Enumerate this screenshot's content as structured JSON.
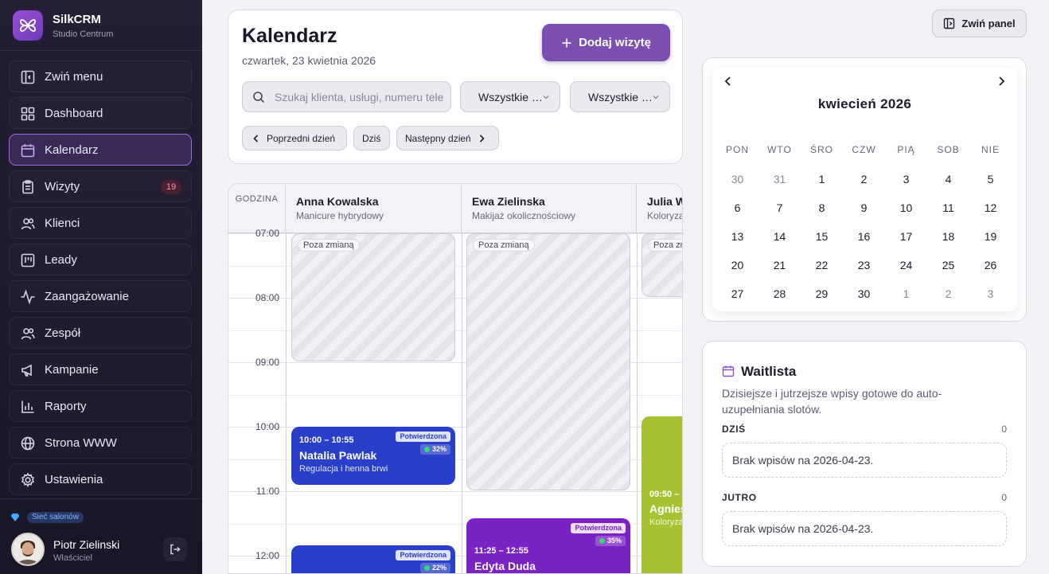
{
  "brand": {
    "name": "SilkCRM",
    "subtitle": "Studio Centrum"
  },
  "sidebar": {
    "items": [
      {
        "label": "Zwiń menu",
        "icon": "collapse-sidebar-icon"
      },
      {
        "label": "Dashboard",
        "icon": "dashboard-icon"
      },
      {
        "label": "Kalendarz",
        "icon": "calendar-icon",
        "active": true
      },
      {
        "label": "Wizyty",
        "icon": "clipboard-icon",
        "badge": "19"
      },
      {
        "label": "Klienci",
        "icon": "users-icon"
      },
      {
        "label": "Leady",
        "icon": "kanban-icon"
      },
      {
        "label": "Zaangażowanie",
        "icon": "activity-icon"
      },
      {
        "label": "Zespół",
        "icon": "team-icon"
      },
      {
        "label": "Kampanie",
        "icon": "megaphone-icon"
      },
      {
        "label": "Raporty",
        "icon": "bar-chart-icon"
      },
      {
        "label": "Strona WWW",
        "icon": "globe-icon"
      },
      {
        "label": "Ustawienia",
        "icon": "gear-icon"
      }
    ],
    "network_badge": "Sieć salonów",
    "user": {
      "name": "Piotr Zielinski",
      "role": "Właściciel"
    }
  },
  "header": {
    "title": "Kalendarz",
    "date": "czwartek, 23 kwietnia 2026",
    "add_button": "Dodaj wizytę",
    "search_placeholder": "Szukaj klienta, usługi, numeru telefonu",
    "filter_1": "Wszystkie specjalistki",
    "filter_2": "Wszystkie usługi",
    "prev_day": "Poprzedni dzień",
    "today": "Dziś",
    "next_day": "Następny dzień"
  },
  "grid": {
    "hour_header": "GODZINA",
    "hours": [
      "07:00",
      "08:00",
      "09:00",
      "10:00",
      "11:00",
      "12:00"
    ],
    "staff": [
      {
        "name": "Anna Kowalska",
        "role": "Manicure hybrydowy"
      },
      {
        "name": "Ewa Zielinska",
        "role": "Makijaż okolicznościowy"
      },
      {
        "name": "Julia W",
        "role": "Koloryza"
      }
    ],
    "off_shift_label": "Poza zmianą",
    "appointments": [
      {
        "time": "10:00 – 10:55",
        "client": "Natalia Pawlak",
        "service": "Regulacja i henna brwi",
        "status": "Potwierdzona",
        "pct": "32%",
        "color": "#2a3fc9"
      },
      {
        "time": "",
        "client": "",
        "service": "",
        "status": "Potwierdzona",
        "pct": "22%",
        "color": "#2a3fc9"
      },
      {
        "time": "11:25 – 12:55",
        "client": "Edyta Duda",
        "service": "",
        "status": "Potwierdzona",
        "pct": "35%",
        "color": "#7b22c4"
      },
      {
        "time": "09:50 –",
        "client": "Agnies",
        "service": "Koloryza",
        "status": "",
        "pct": "",
        "color": "#a6c232"
      }
    ]
  },
  "right_panel": {
    "collapse_button": "Zwiń panel",
    "mini_calendar": {
      "title": "kwiecień 2026",
      "weekdays": [
        "PON",
        "WTO",
        "ŚRO",
        "CZW",
        "PIĄ",
        "SOB",
        "NIE"
      ],
      "days": [
        "30",
        "31",
        "1",
        "2",
        "3",
        "4",
        "5",
        "6",
        "7",
        "8",
        "9",
        "10",
        "11",
        "12",
        "13",
        "14",
        "15",
        "16",
        "17",
        "18",
        "19",
        "20",
        "21",
        "22",
        "23",
        "24",
        "25",
        "26",
        "27",
        "28",
        "29",
        "30",
        "1",
        "2",
        "3"
      ]
    },
    "waitlist": {
      "title": "Waitlista",
      "description": "Dzisiejsze i jutrzejsze wpisy gotowe do auto-uzupełniania slotów.",
      "today_label": "DZIŚ",
      "today_count": "0",
      "today_empty": "Brak wpisów na 2026-04-23.",
      "tomorrow_label": "JUTRO",
      "tomorrow_count": "0",
      "tomorrow_empty": "Brak wpisów na 2026-04-23."
    }
  }
}
